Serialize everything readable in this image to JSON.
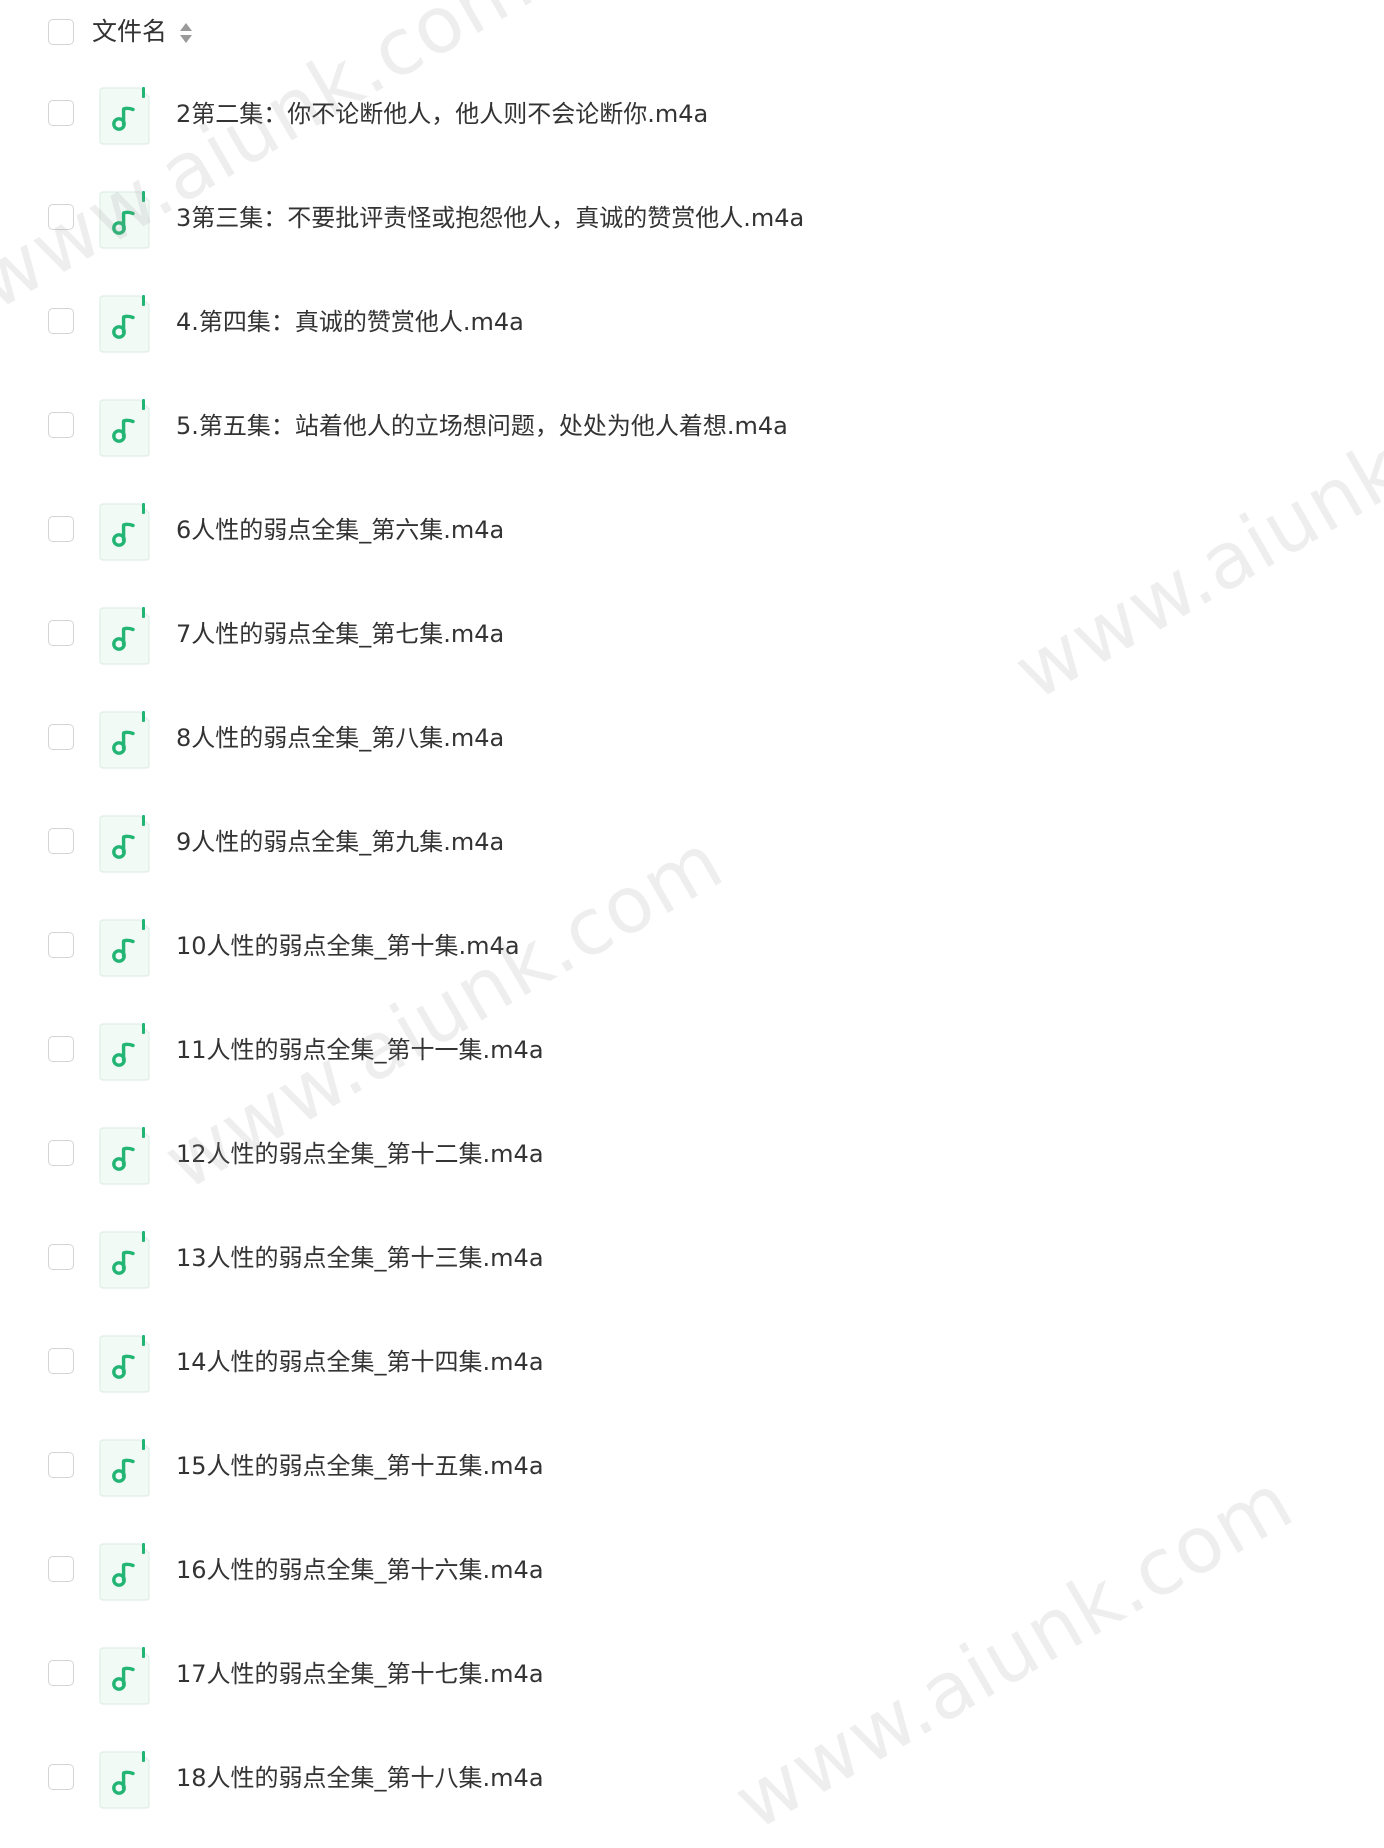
{
  "header": {
    "column_label": "文件名",
    "sort_icon": "sort-updown-icon"
  },
  "file_icon": "music-note-icon",
  "colors": {
    "accent": "#22b573",
    "icon_bg": "#f2faf6",
    "checkbox_border": "#d4d4d8",
    "text": "#333333"
  },
  "files": [
    {
      "name": "2第二集：你不论断他人，他人则不会论断你.m4a"
    },
    {
      "name": "3第三集：不要批评责怪或抱怨他人，真诚的赞赏他人.m4a"
    },
    {
      "name": "4.第四集：真诚的赞赏他人.m4a"
    },
    {
      "name": "5.第五集：站着他人的立场想问题，处处为他人着想.m4a"
    },
    {
      "name": "6人性的弱点全集_第六集.m4a"
    },
    {
      "name": "7人性的弱点全集_第七集.m4a"
    },
    {
      "name": "8人性的弱点全集_第八集.m4a"
    },
    {
      "name": "9人性的弱点全集_第九集.m4a"
    },
    {
      "name": "10人性的弱点全集_第十集.m4a"
    },
    {
      "name": "11人性的弱点全集_第十一集.m4a"
    },
    {
      "name": "12人性的弱点全集_第十二集.m4a"
    },
    {
      "name": "13人性的弱点全集_第十三集.m4a"
    },
    {
      "name": "14人性的弱点全集_第十四集.m4a"
    },
    {
      "name": "15人性的弱点全集_第十五集.m4a"
    },
    {
      "name": "16人性的弱点全集_第十六集.m4a"
    },
    {
      "name": "17人性的弱点全集_第十七集.m4a"
    },
    {
      "name": "18人性的弱点全集_第十八集.m4a"
    }
  ]
}
